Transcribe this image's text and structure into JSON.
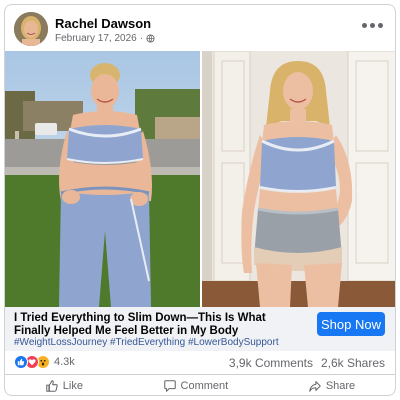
{
  "post": {
    "author": "Rachel Dawson",
    "date": "February 17, 2026",
    "audience_icon": "globe-icon",
    "more_icon": "more-options-icon"
  },
  "ad": {
    "headline": "I Tried Everything to Slim Down—This Is What Finally Helped Me Feel Better in My Body",
    "hashtags": "#WeightLossJourney #TriedEverything #LowerBodySupport",
    "cta": "Shop Now"
  },
  "stats": {
    "reaction_count": "4.3k",
    "reaction_icons": [
      "like-reaction-icon",
      "love-reaction-icon",
      "wow-reaction-icon"
    ],
    "comments": "3,9k Comments",
    "shares": "2,6k Shares"
  },
  "actions": [
    {
      "label": "Like",
      "icon": "thumbs-up-icon"
    },
    {
      "label": "Comment",
      "icon": "comment-icon"
    },
    {
      "label": "Share",
      "icon": "share-icon"
    }
  ],
  "colors": {
    "accent": "#1877f2",
    "hashtag": "#385898",
    "muted_text": "#65676b",
    "ad_bar_bg": "#f0f2f5",
    "outfit_blue": "#8fa5cf"
  }
}
